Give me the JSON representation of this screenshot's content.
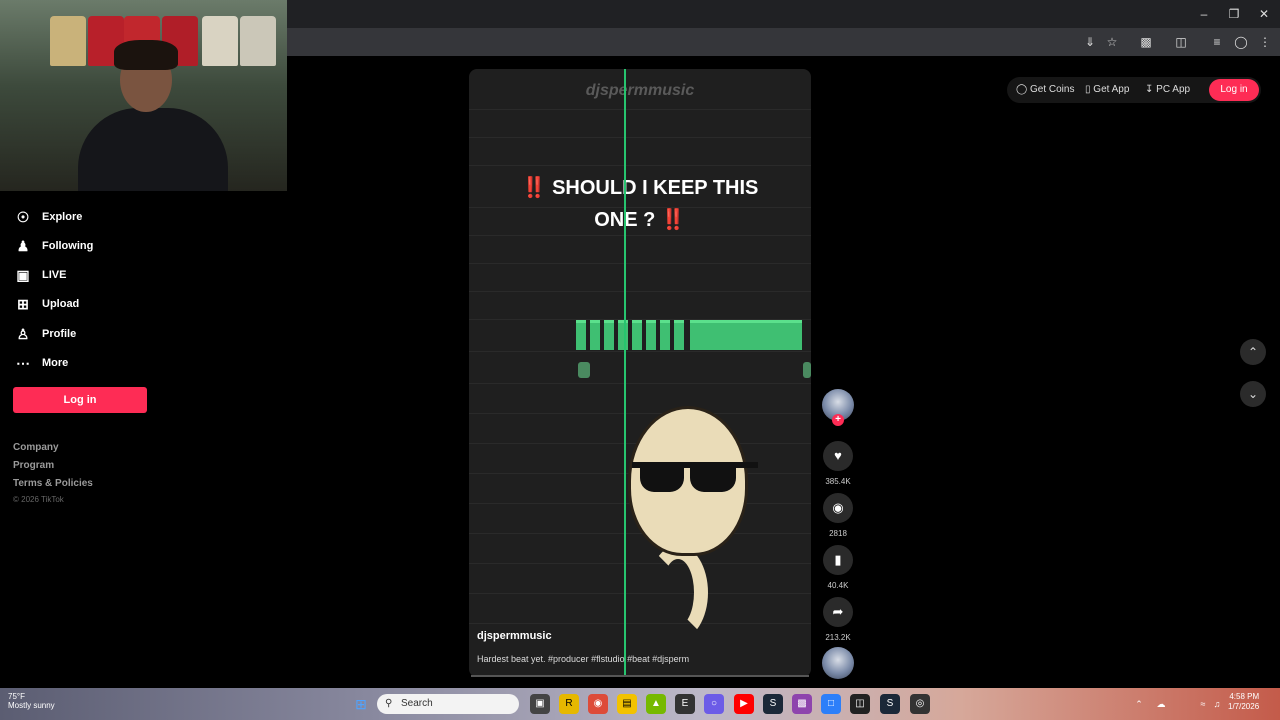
{
  "sidebar": {
    "items": [
      {
        "label": "Explore",
        "icon": "compass-icon"
      },
      {
        "label": "Following",
        "icon": "following-icon"
      },
      {
        "label": "LIVE",
        "icon": "live-icon"
      },
      {
        "label": "Upload",
        "icon": "upload-icon"
      },
      {
        "label": "Profile",
        "icon": "profile-icon"
      },
      {
        "label": "More",
        "icon": "more-icon"
      }
    ],
    "login_label": "Log in",
    "footer": {
      "company": "Company",
      "program": "Program",
      "terms": "Terms & Policies",
      "copyright": "© 2026 TikTok"
    }
  },
  "header": {
    "get_coins": "Get Coins",
    "get_app": "Get App",
    "pc_app": "PC App",
    "login_label": "Log in"
  },
  "video": {
    "watermark": "djspermmusic",
    "caption_line1": "SHOULD I KEEP THIS",
    "caption_line2": "ONE ?",
    "caption_mark": "‼️",
    "username": "djspermmusic",
    "description": "Hardest beat yet. #producer #flstudio #beat #djsperm"
  },
  "actions": {
    "likes": "385.4K",
    "comments": "2818",
    "saves": "40.4K",
    "shares": "213.2K"
  },
  "taskbar": {
    "weather": "75°F",
    "weather_sub": "Mostly sunny",
    "search_placeholder": "Search",
    "time": "4:58 PM",
    "date": "1/7/2026"
  },
  "colors": {
    "accent": "#fe2c55",
    "playhead": "#27c46f"
  }
}
